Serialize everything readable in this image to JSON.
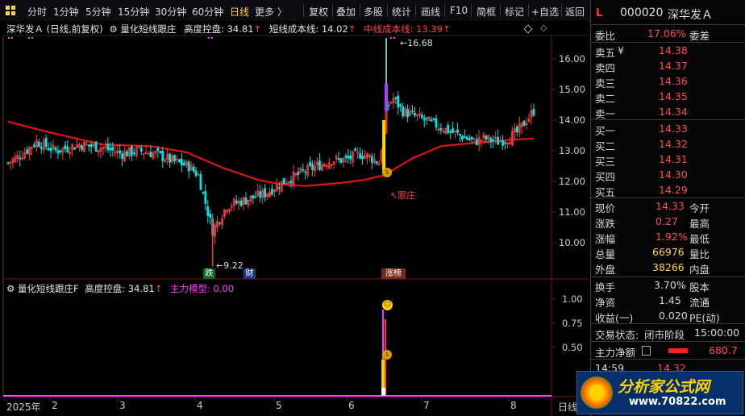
{
  "toolbar": {
    "left_icon": "grid-icon",
    "periods": [
      "分时",
      "1分钟",
      "5分钟",
      "15分钟",
      "30分钟",
      "60分钟",
      "日线",
      "更多 〉"
    ],
    "active_period": "日线",
    "actions": [
      "复权",
      "叠加",
      "多股",
      "统计",
      "画线",
      "F10",
      "简框",
      "标记",
      "+自选",
      "返回"
    ]
  },
  "main_chart": {
    "stock_title": "深华发Ａ",
    "mode": "(日线,前复权)",
    "indicator_name": "量化短线跟庄",
    "height_label": "高度控盘: 34.81",
    "short_cost_label": "短线成本线: 14.02",
    "mid_cost_label": "中线成本线: 13.39",
    "arrow_up": "↑",
    "y_ticks": [
      "16.00",
      "15.00",
      "14.00",
      "13.00",
      "12.00",
      "11.00",
      "10.00"
    ],
    "high_marker": "16.68",
    "low_marker": "9.22",
    "follow_label": "↖跟庄",
    "badges": {
      "die": "跌",
      "cai": "财",
      "zhangting": "涨榜"
    },
    "colors": {
      "up": "#ff3b3b",
      "down": "#00e5e5",
      "ma": "#e01414",
      "signal": "#ffd700",
      "purple": "#b040ff"
    }
  },
  "sub_chart": {
    "indicator_name": "量化短线跟庄F",
    "height_label": "高度控盘: 34.81",
    "arrow_up": "↑",
    "model_label": "主力模型: 0.00",
    "y_ticks": [
      "1.00",
      "0.75",
      "0.50"
    ]
  },
  "x_axis": {
    "labels": [
      "2025年",
      "2",
      "3",
      "4",
      "5",
      "6",
      "7",
      "8"
    ],
    "corner": "日线"
  },
  "quote_panel": {
    "badge": "L",
    "code": "000020",
    "name": "深华发Ａ",
    "wei_bi_label": "委比",
    "wei_bi_value": "17.06%",
    "wei_cha_label": "委差",
    "sell": [
      {
        "label": "卖五",
        "price": "14.38",
        "yen": "¥"
      },
      {
        "label": "卖四",
        "price": "14.37"
      },
      {
        "label": "卖三",
        "price": "14.36"
      },
      {
        "label": "卖二",
        "price": "14.35"
      },
      {
        "label": "卖一",
        "price": "14.34"
      }
    ],
    "buy": [
      {
        "label": "买一",
        "price": "14.33"
      },
      {
        "label": "买二",
        "price": "14.32"
      },
      {
        "label": "买三",
        "price": "14.31"
      },
      {
        "label": "买四",
        "price": "14.30"
      },
      {
        "label": "买五",
        "price": "14.29"
      }
    ],
    "stats": [
      {
        "l1": "现价",
        "v1": "14.33",
        "l2": "今开"
      },
      {
        "l1": "涨跌",
        "v1": "0.27",
        "l2": "最高"
      },
      {
        "l1": "涨幅",
        "v1": "1.92%",
        "l2": "最低"
      },
      {
        "l1": "总量",
        "v1": "66976",
        "l2": "量比"
      },
      {
        "l1": "外盘",
        "v1": "38266",
        "l2": "内盘"
      }
    ],
    "fin": [
      {
        "l1": "换手",
        "v1": "3.70%",
        "l2": "股本"
      },
      {
        "l1": "净资",
        "v1": "1.45",
        "l2": "流通"
      },
      {
        "l1": "收益(一)",
        "v1": "0.020",
        "l2": "PE(动)"
      }
    ],
    "trade_status_label": "交易状态:",
    "trade_status_value": "闭市阶段",
    "trade_time": "15:00:00",
    "net_label": "主力净额",
    "net_value": "680.7",
    "tick_time": "14:59",
    "tick_price": "14.32"
  },
  "watermark": {
    "text": "分析家公式网",
    "url": "www.70822.com"
  }
}
